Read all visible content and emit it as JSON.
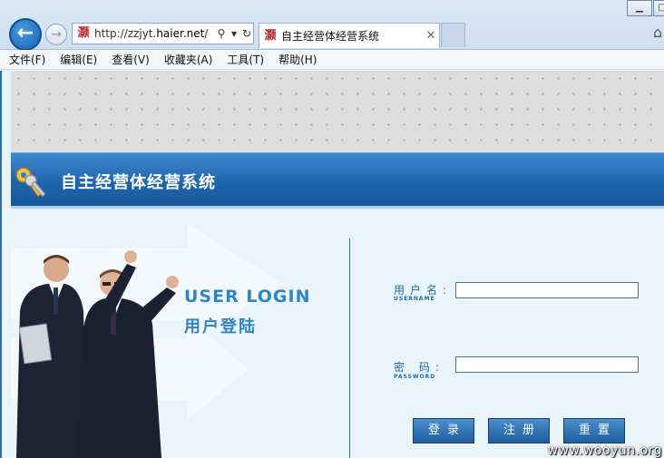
{
  "browser": {
    "address_url": "http://zzjyt.haier.net/",
    "address_url_prefix": "http://zzjyt.",
    "address_url_domain": "haier.net",
    "address_url_suffix": "/",
    "tab_title": "自主经营体经营系统",
    "favicon_text": "灏",
    "close_tab": "✕"
  },
  "menu": {
    "items": [
      "文件(F)",
      "编辑(E)",
      "查看(V)",
      "收藏夹(A)",
      "工具(T)",
      "帮助(H)"
    ]
  },
  "page": {
    "banner_title": "自主经营体经营系统",
    "user_login_en": "USER LOGIN",
    "user_login_cn": "用户登陆",
    "username_label": "用户名:",
    "username_sub": "USERNAME",
    "password_label": "密 码:",
    "password_sub": "PASSWORD",
    "username_value": "",
    "password_value": "",
    "login_button": "登录",
    "register_button": "注册",
    "reset_button": "重置"
  },
  "watermark": "www.wooyun.org",
  "colors": {
    "banner_blue": "#1f65ad",
    "accent_text": "#2d86c9",
    "button_blue": "#2d6fb0"
  }
}
